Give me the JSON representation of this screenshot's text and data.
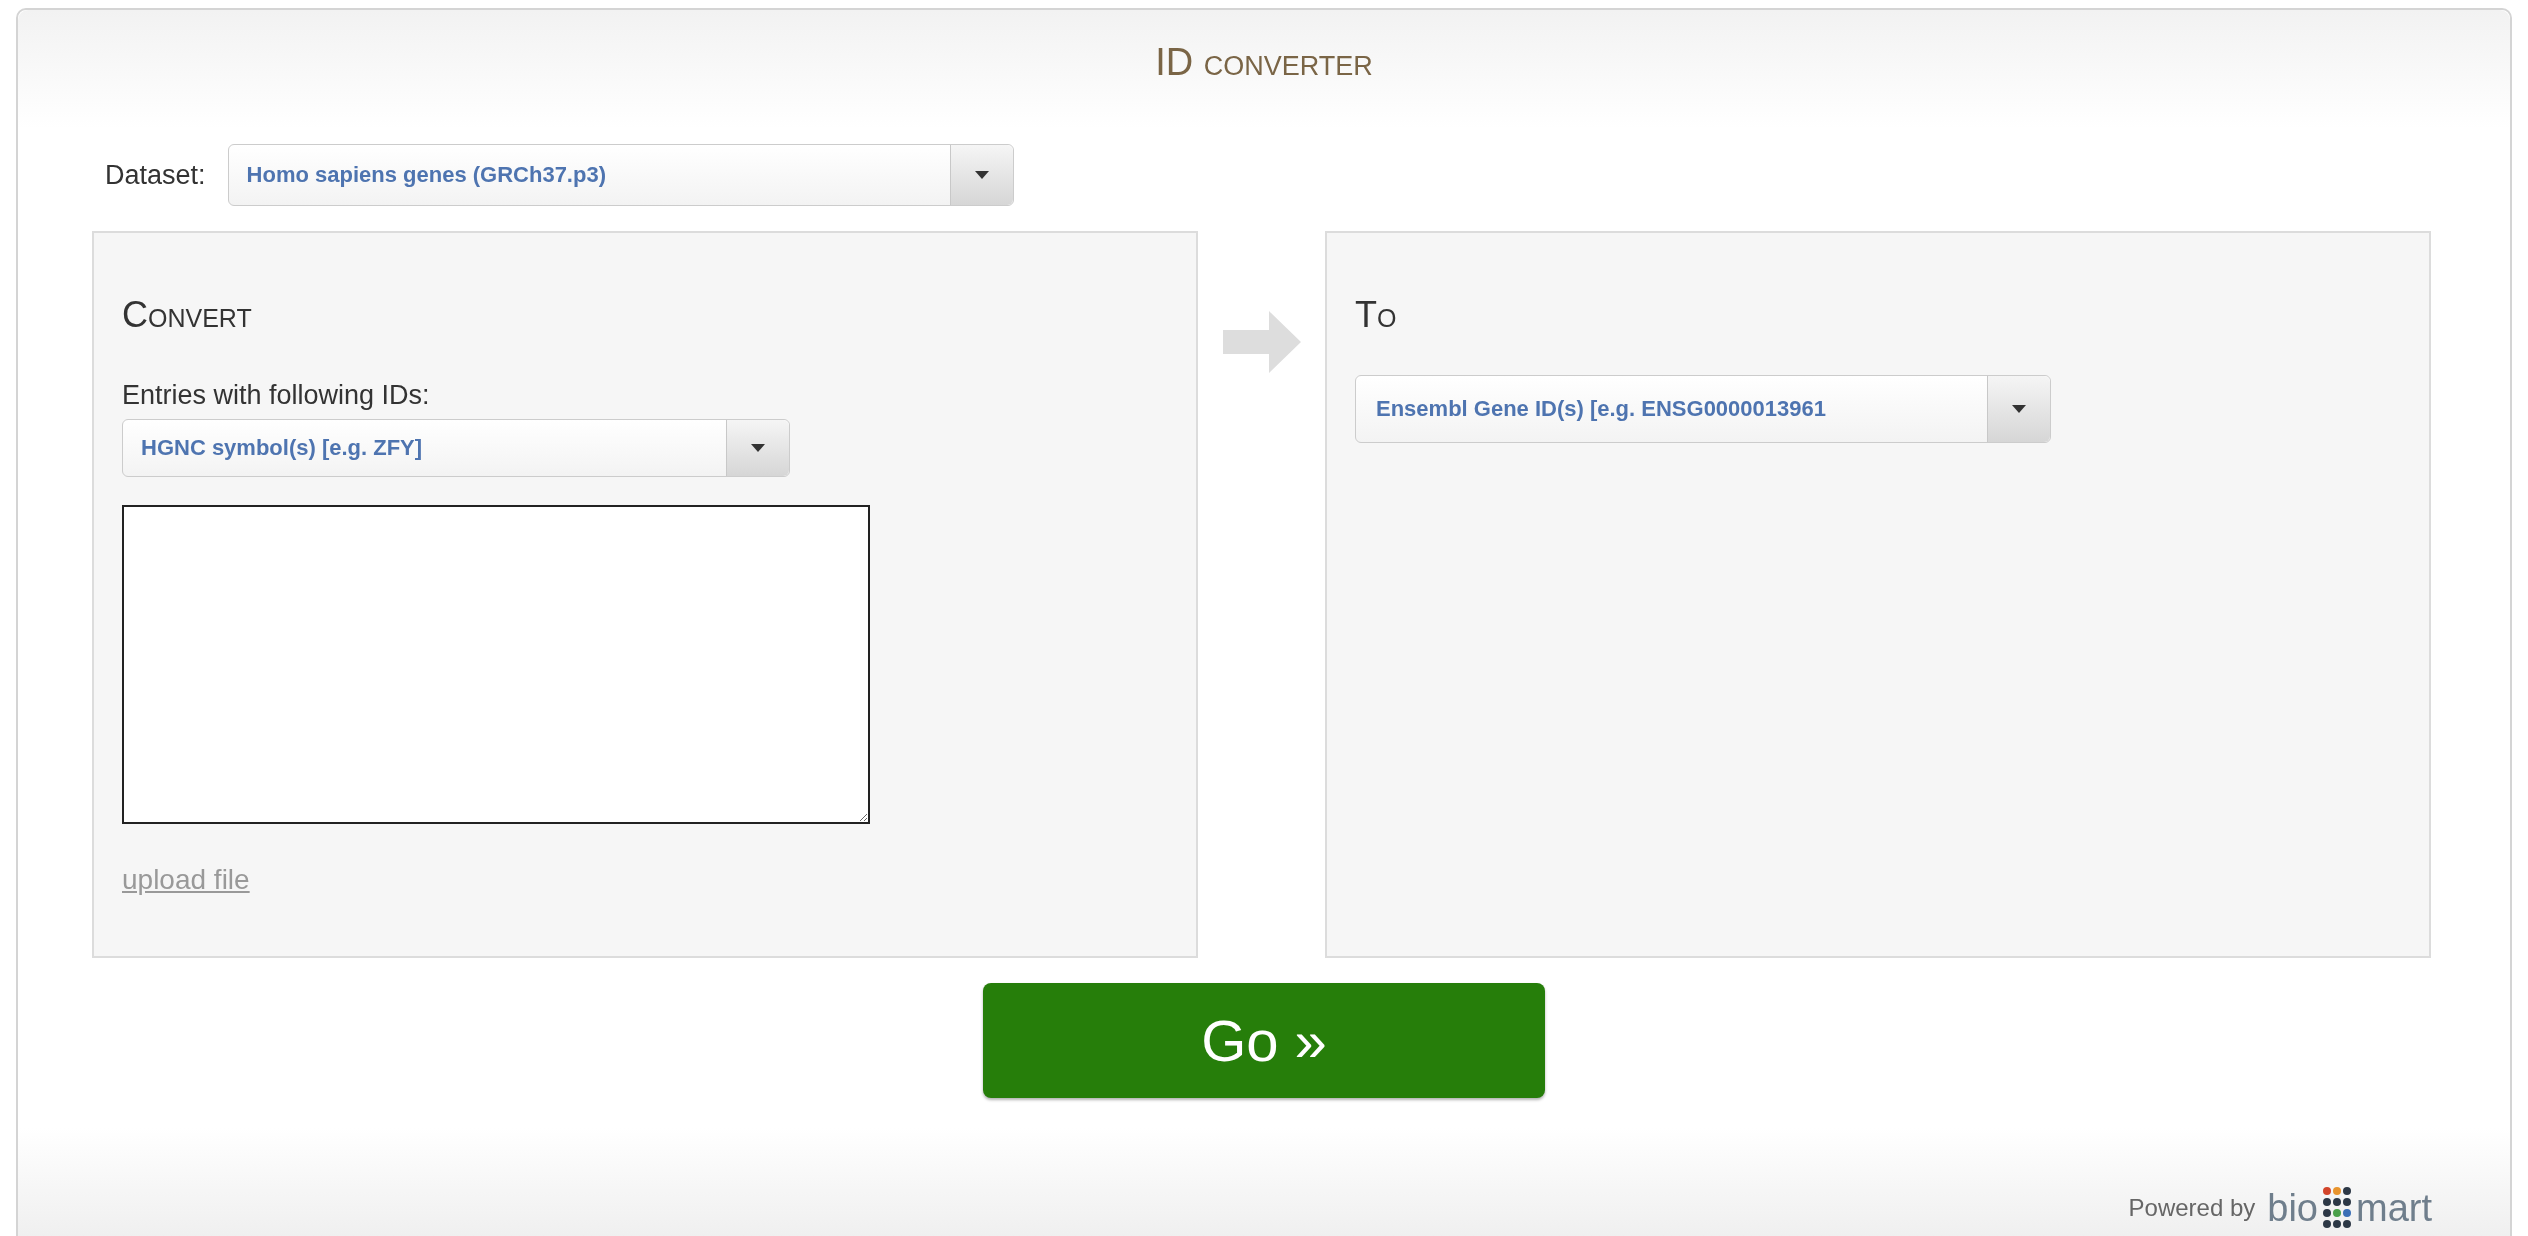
{
  "header": {
    "title": "ID converter"
  },
  "dataset": {
    "label": "Dataset:",
    "value": "Homo sapiens genes (GRCh37.p3)"
  },
  "convert_panel": {
    "heading": "Convert",
    "label": "Entries with following IDs:",
    "id_type": "HGNC symbol(s) [e.g. ZFY]",
    "link": "upload file"
  },
  "to_panel": {
    "heading": "To",
    "id_type": "Ensembl Gene ID(s) [e.g. ENSG0000013961"
  },
  "go_button": "Go »",
  "footer": {
    "powered_by": "Powered by",
    "logo_left": "bio",
    "logo_right": "mart"
  }
}
